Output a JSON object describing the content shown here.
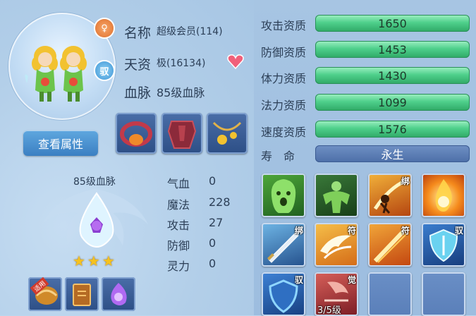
{
  "pet": {
    "name_label": "名称",
    "name_value": "超级会员(114)",
    "talent_label": "天资",
    "talent_value": "极(16134)",
    "bloodline_label": "血脉",
    "bloodline_value": "85级血脉",
    "tame_badge": "驭",
    "view_attr_button": "查看属性"
  },
  "bloodline_panel": {
    "title": "85级血脉",
    "stars": 3,
    "stats": [
      {
        "label": "气血",
        "value": "0"
      },
      {
        "label": "魔法",
        "value": "228"
      },
      {
        "label": "攻击",
        "value": "27"
      },
      {
        "label": "防御",
        "value": "0"
      },
      {
        "label": "灵力",
        "value": "0"
      }
    ],
    "item_tag": "适用"
  },
  "aptitudes": [
    {
      "label": "攻击资质",
      "value": "1650"
    },
    {
      "label": "防御资质",
      "value": "1453"
    },
    {
      "label": "体力资质",
      "value": "1430"
    },
    {
      "label": "法力资质",
      "value": "1099"
    },
    {
      "label": "速度资质",
      "value": "1576"
    }
  ],
  "lifespan": {
    "label": "寿　命",
    "value": "永生"
  },
  "skills": [
    {
      "icon": "ghost-skill",
      "tag": ""
    },
    {
      "icon": "strongman-skill",
      "tag": ""
    },
    {
      "icon": "slash-skill",
      "tag": "绑"
    },
    {
      "icon": "flame-skill",
      "tag": ""
    },
    {
      "icon": "sword-skill",
      "tag": "绑"
    },
    {
      "icon": "wing-skill",
      "tag": "符"
    },
    {
      "icon": "blade-skill",
      "tag": "符"
    },
    {
      "icon": "shield-skill",
      "tag": "驭"
    },
    {
      "icon": "ward-skill",
      "tag": "驭"
    },
    {
      "icon": "awaken-skill",
      "tag": "觉",
      "caption": "3/5级"
    },
    {
      "icon": "empty-slot",
      "tag": ""
    },
    {
      "icon": "empty-slot",
      "tag": ""
    }
  ],
  "colors": {
    "bar_green": "#4fd08c",
    "life_bar": "#5a7bb3",
    "panel_bg": "#a9c9e6"
  }
}
